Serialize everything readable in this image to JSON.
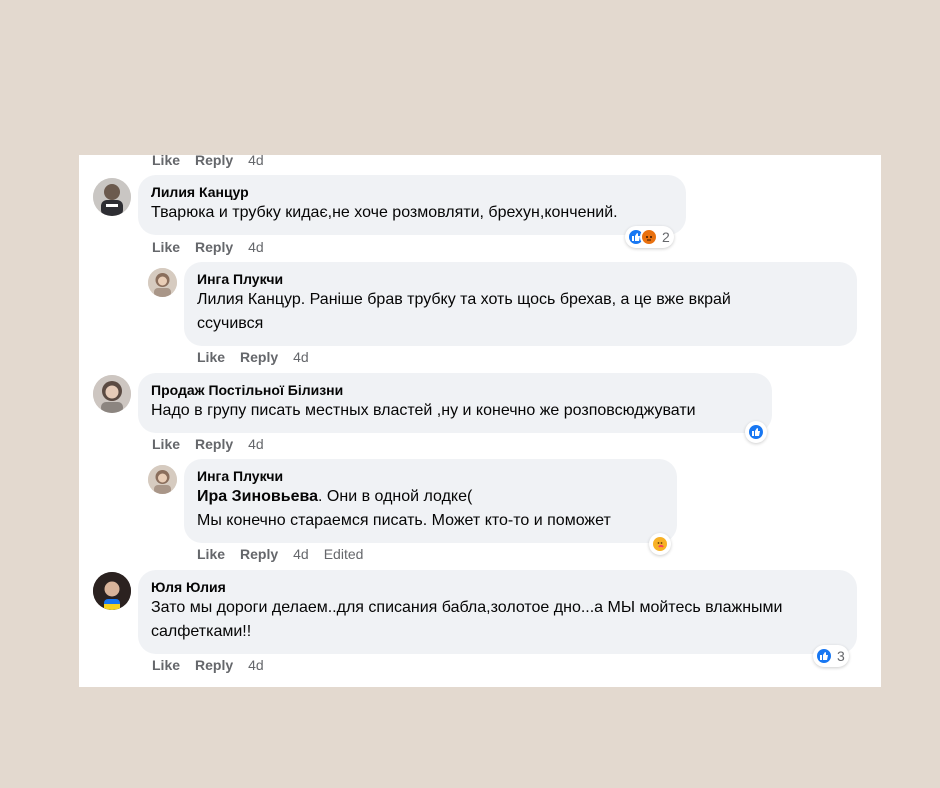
{
  "colors": {
    "background": "#e3d9cf",
    "card": "#ffffff",
    "bubble": "#f0f2f5",
    "meta": "#65676b",
    "like": "#1877f2"
  },
  "actions": {
    "like": "Like",
    "reply": "Reply"
  },
  "top_row": {
    "time": "4d"
  },
  "comments": [
    {
      "author": "Лилия Канцур",
      "lines": [
        "Тварюка и трубку кидає,не хоче розмовляти, брехун,кончений."
      ],
      "time": "4d",
      "reactions": {
        "icons": [
          "like-icon",
          "angry-icon"
        ],
        "count": "2"
      }
    },
    {
      "author": "Инга Плукчи",
      "lines": [
        "Лилия Канцур. Раніше брав трубку та хоть щось брехав, а це вже вкрай",
        "ссучився"
      ],
      "time": "4d"
    },
    {
      "author": "Продаж Постільної Білизни",
      "lines": [
        "Надо в групу писать местных властей ,ну и конечно же розповсюджувати"
      ],
      "time": "4d",
      "reactions": {
        "icons": [
          "like-icon"
        ]
      }
    },
    {
      "author": "Инга Плукчи",
      "mention": "Ира Зиновьева",
      "line1_rest": ". Они в одной лодке(",
      "line2": "Мы конечно стараемся писать. Может кто-то и поможет",
      "time": "4d",
      "edited": "Edited",
      "reactions": {
        "icons": [
          "care-icon"
        ]
      }
    },
    {
      "author": "Юля Юлия",
      "lines": [
        "Зато мы дороги делаем..для списания бабла,золотое дно...а МЫ мойтесь влажными",
        "салфетками!!"
      ],
      "time": "4d",
      "reactions": {
        "icons": [
          "like-icon"
        ],
        "count": "3"
      }
    }
  ]
}
